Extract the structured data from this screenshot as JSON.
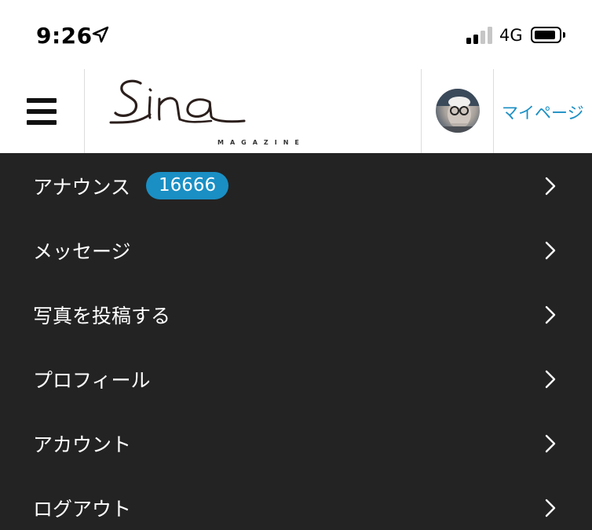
{
  "status_bar": {
    "time": "9:26",
    "network": "4G",
    "location_icon": "location-arrow-icon",
    "signal_icon": "cellular-signal-icon",
    "battery_icon": "battery-icon"
  },
  "header": {
    "menu_icon": "hamburger-menu-icon",
    "logo_text": "Sino",
    "logo_sub": "MAGAZINE",
    "mypage_label": "マイページ"
  },
  "menu": {
    "items": [
      {
        "label": "アナウンス",
        "badge": "16666"
      },
      {
        "label": "メッセージ"
      },
      {
        "label": "写真を投稿する"
      },
      {
        "label": "プロフィール"
      },
      {
        "label": "アカウント"
      },
      {
        "label": "ログアウト"
      }
    ],
    "chevron_icon": "chevron-right-icon"
  },
  "colors": {
    "accent": "#1a8fc4",
    "menu_background": "#232323",
    "header_background": "#ffffff"
  }
}
